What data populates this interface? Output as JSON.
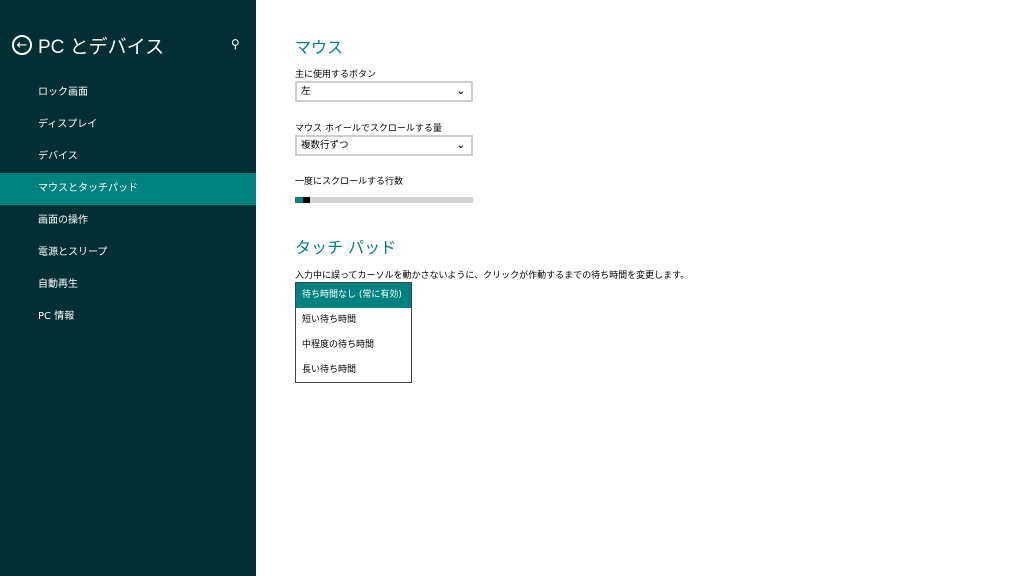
{
  "sidebar": {
    "title": "PC とデバイス",
    "icons": {
      "back": "back-arrow-icon",
      "search": "search-icon"
    },
    "items": [
      {
        "label": "ロック画面"
      },
      {
        "label": "ディスプレイ"
      },
      {
        "label": "デバイス"
      },
      {
        "label": "マウスとタッチパッド",
        "selected": true
      },
      {
        "label": "画面の操作"
      },
      {
        "label": "電源とスリープ"
      },
      {
        "label": "自動再生"
      },
      {
        "label": "PC 情報"
      }
    ]
  },
  "mouse": {
    "heading": "マウス",
    "primary_button_label": "主に使用するボタン",
    "primary_button_value": "左",
    "scroll_amount_label": "マウス ホイールでスクロールする量",
    "scroll_amount_value": "複数行ずつ",
    "lines_label": "一度にスクロールする行数",
    "lines_value": 3,
    "lines_range": [
      1,
      100
    ]
  },
  "touchpad": {
    "heading": "タッチ パッド",
    "description": "入力中に誤ってカーソルを動かさないように、クリックが作動するまでの待ち時間を変更します。",
    "options": [
      {
        "label": "待ち時間なし (常に有効)",
        "selected": true
      },
      {
        "label": "短い待ち時間"
      },
      {
        "label": "中程度の待ち時間"
      },
      {
        "label": "長い待ち時間"
      }
    ]
  },
  "colors": {
    "sidebar_bg": "#012f33",
    "accent": "#008281"
  }
}
